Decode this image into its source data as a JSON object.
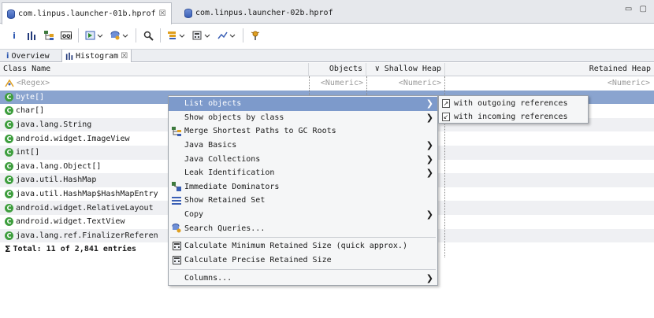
{
  "editor_tabs": [
    {
      "label": "com.linpus.launcher-01b.hprof",
      "close": "☒",
      "active": true
    },
    {
      "label": "com.linpus.launcher-02b.hprof",
      "active": false
    }
  ],
  "window_controls": "▭ ▢",
  "view_tabs": [
    {
      "icon": "i",
      "label": "Overview"
    },
    {
      "label": "Histogram",
      "close": "☒"
    }
  ],
  "table": {
    "headers": {
      "class_name": "Class Name",
      "objects": "Objects",
      "sort_glyph": "∨",
      "shallow": "Shallow Heap",
      "retained": "Retained Heap"
    },
    "filters": {
      "class_name": "<Regex>",
      "objects": "<Numeric>",
      "shallow": "<Numeric>",
      "retained": "<Numeric>"
    },
    "rows": [
      "byte[]",
      "char[]",
      "java.lang.String",
      "android.widget.ImageView",
      "int[]",
      "java.lang.Object[]",
      "java.util.HashMap",
      "java.util.HashMap$HashMapEntry",
      "android.widget.RelativeLayout",
      "android.widget.TextView",
      "java.lang.ref.FinalizerReferen"
    ],
    "total": "Total: 11 of 2,841 entries"
  },
  "context_menu": {
    "items": [
      {
        "label": "List objects",
        "submenu": true,
        "highlighted": true
      },
      {
        "label": "Show objects by class",
        "submenu": true
      },
      {
        "label": "Merge Shortest Paths to GC Roots",
        "icon": "tree-icon"
      },
      {
        "label": "Java Basics",
        "submenu": true
      },
      {
        "label": "Java Collections",
        "submenu": true
      },
      {
        "label": "Leak Identification",
        "submenu": true
      },
      {
        "label": "Immediate Dominators",
        "icon": "dominator-icon"
      },
      {
        "label": "Show Retained Set",
        "icon": "retained-set-icon"
      },
      {
        "label": "Copy",
        "submenu": true
      },
      {
        "label": "Search Queries...",
        "icon": "search-queries-icon"
      },
      {
        "label": "Calculate Minimum Retained Size (quick approx.)",
        "icon": "calculator-icon"
      },
      {
        "label": "Calculate Precise Retained Size",
        "icon": "calculator-icon"
      },
      {
        "label": "Columns...",
        "submenu": true
      }
    ],
    "submenu_arrow": "❯"
  },
  "submenu": {
    "items": [
      {
        "label": "with outgoing references"
      },
      {
        "label": "with incoming references"
      }
    ]
  }
}
